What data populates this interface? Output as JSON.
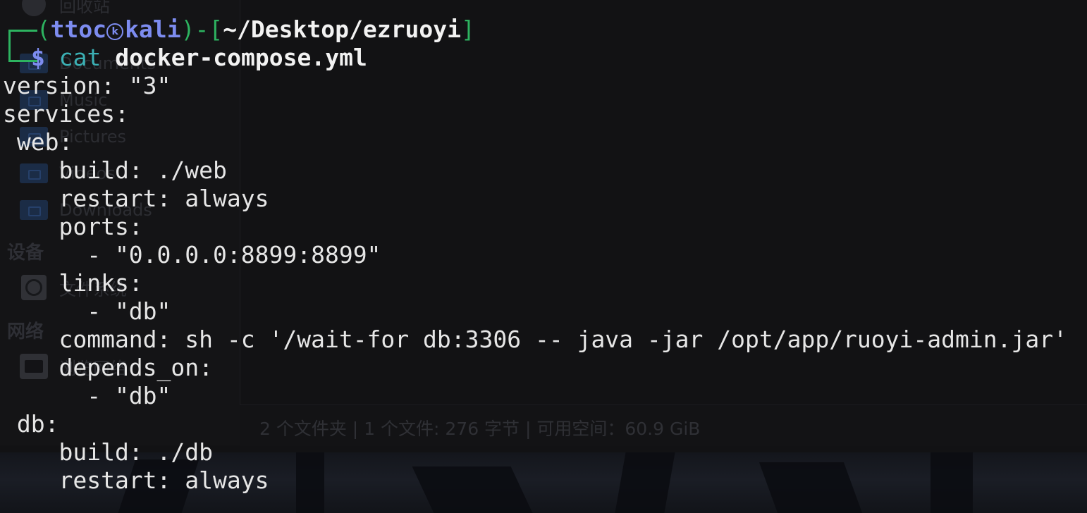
{
  "file_manager": {
    "sidebar": {
      "places": [
        {
          "label": "回收站",
          "icon": "trash-icon"
        },
        {
          "label": "Documents",
          "icon": "folder-documents-icon"
        },
        {
          "label": "Music",
          "icon": "folder-music-icon"
        },
        {
          "label": "Pictures",
          "icon": "folder-pictures-icon"
        },
        {
          "label": "Videos",
          "icon": "folder-videos-icon"
        },
        {
          "label": "Downloads",
          "icon": "folder-downloads-icon"
        }
      ],
      "devices_header": "设备",
      "devices": [
        {
          "label": "文件系统",
          "icon": "drive-icon"
        }
      ],
      "network_header": "网络",
      "network": [
        {
          "label": "浏览网络",
          "icon": "network-icon"
        }
      ]
    },
    "status_bar": "2 个文件夹 | 1 个文件: 276 字节 | 可用空间：60.9 GiB"
  },
  "terminal": {
    "prompt": {
      "open_paren": "┌──(",
      "user": "ttoc",
      "host": "kali",
      "close_paren": ")-[",
      "cwd": "~/Desktop/ezruoyi",
      "close_bracket": "]",
      "corner_bottom": "└─",
      "symbol": "$",
      "command": "cat",
      "argument": "docker-compose.yml"
    },
    "output": [
      "version: \"3\"",
      "services:",
      " web:",
      "    build: ./web",
      "    restart: always",
      "    ports:",
      "      - \"0.0.0.0:8899:8899\"",
      "    links:",
      "      - \"db\"",
      "    command: sh -c '/wait-for db:3306 -- java -jar /opt/app/ruoyi-admin.jar'",
      "    depends_on:",
      "      - \"db\"",
      " db:",
      "    build: ./db",
      "    restart: always"
    ]
  }
}
